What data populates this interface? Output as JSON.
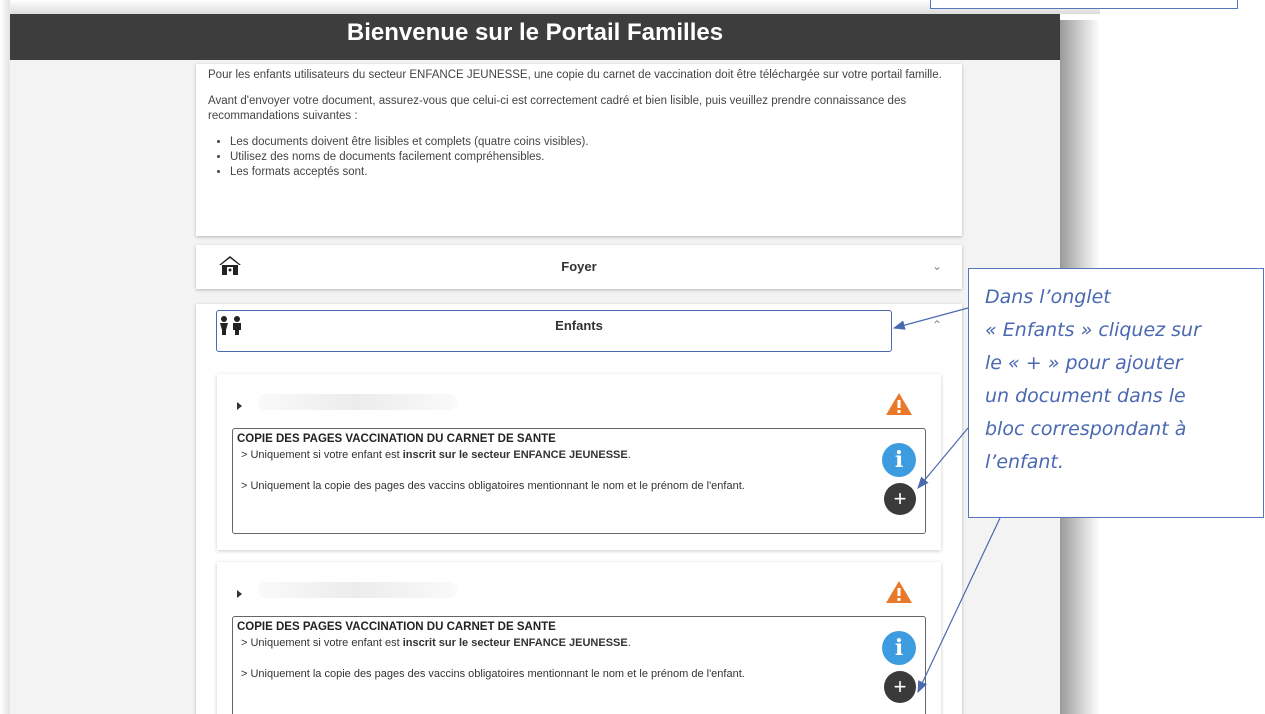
{
  "header": {
    "title": "Bienvenue sur le Portail Familles"
  },
  "intro": {
    "paragraph1": "Pour les enfants utilisateurs du secteur ENFANCE JEUNESSE, une copie du carnet de vaccination doit être téléchargée sur votre portail famille.",
    "paragraph2": "Avant d'envoyer votre document, assurez-vous que celui-ci est correctement cadré et bien lisible, puis veuillez prendre connaissance des recommandations suivantes :",
    "bullets": [
      "Les documents doivent être lisibles et complets (quatre coins visibles).",
      "Utilisez des noms de documents facilement compréhensibles.",
      "Les formats acceptés sont."
    ]
  },
  "sections": {
    "foyer": {
      "label": "Foyer",
      "icon": "house-icon",
      "state": "collapsed"
    },
    "enfants": {
      "label": "Enfants",
      "icon": "children-icon",
      "state": "expanded"
    }
  },
  "children": [
    {
      "doc_title": "COPIE DES PAGES VACCINATION DU CARNET DE SANTE",
      "line1_prefix": "> Uniquement si votre enfant est ",
      "line1_bold": "inscrit sur le secteur ENFANCE JEUNESSE",
      "line1_suffix": ".",
      "line2": "> Uniquement la copie des pages des vaccins obligatoires mentionnant le nom et le prénom de l'enfant.",
      "status_icon": "warning-icon",
      "warning_color": "#e8792b"
    },
    {
      "doc_title": "COPIE DES PAGES VACCINATION DU CARNET DE SANTE",
      "line1_prefix": "> Uniquement si votre enfant est ",
      "line1_bold": "inscrit sur le secteur ENFANCE JEUNESSE",
      "line1_suffix": ".",
      "line2": "> Uniquement la copie des pages des vaccins obligatoires mentionnant le nom et le prénom de l'enfant.",
      "status_icon": "warning-icon",
      "warning_color": "#e8792b"
    }
  ],
  "buttons": {
    "info_label": "i",
    "add_label": "+"
  },
  "callout": {
    "lines": [
      "Dans l’onglet",
      "« Enfants » cliquez sur",
      "le « + » pour ajouter",
      "un document dans le",
      "bloc correspondant à",
      "l’enfant."
    ],
    "color": "#4a69b0"
  }
}
